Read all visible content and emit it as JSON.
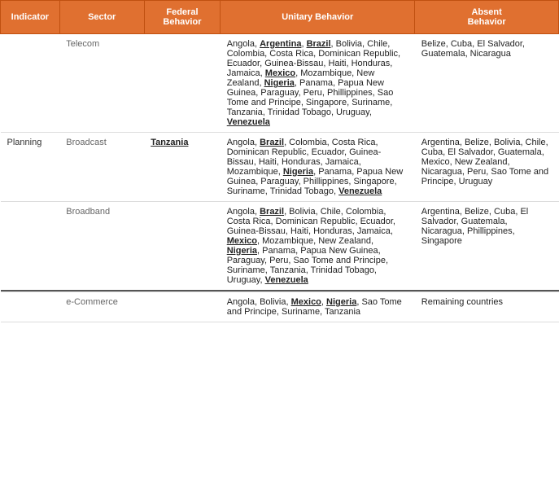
{
  "header": {
    "col1": "Indicator",
    "col2": "Sector",
    "col3": "Federal\nBehavior",
    "col4": "Unitary Behavior",
    "col5": "Absent\nBehavior"
  },
  "rows": [
    {
      "indicator": "",
      "sector": "Telecom",
      "federal": "",
      "unitary": "telecom_unitary",
      "absent": "Belize, Cuba, El Salvador, Guatemala, Nicaragua"
    },
    {
      "indicator": "Planning",
      "sector": "Broadcast",
      "federal": "Tanzania",
      "unitary": "broadcast_unitary",
      "absent": "Argentina, Belize, Bolivia, Chile, Cuba, El Salvador, Guatemala, Mexico, New Zealand, Nicaragua, Peru, Sao Tome and Principe, Uruguay"
    },
    {
      "indicator": "",
      "sector": "Broadband",
      "federal": "",
      "unitary": "broadband_unitary",
      "absent": "Argentina, Belize, Cuba, El Salvador, Guatemala, Nicaragua, Phillippines, Singapore"
    },
    {
      "indicator": "",
      "sector": "e-Commerce",
      "federal": "",
      "unitary": "ecommerce_unitary",
      "absent": "Remaining countries"
    }
  ]
}
